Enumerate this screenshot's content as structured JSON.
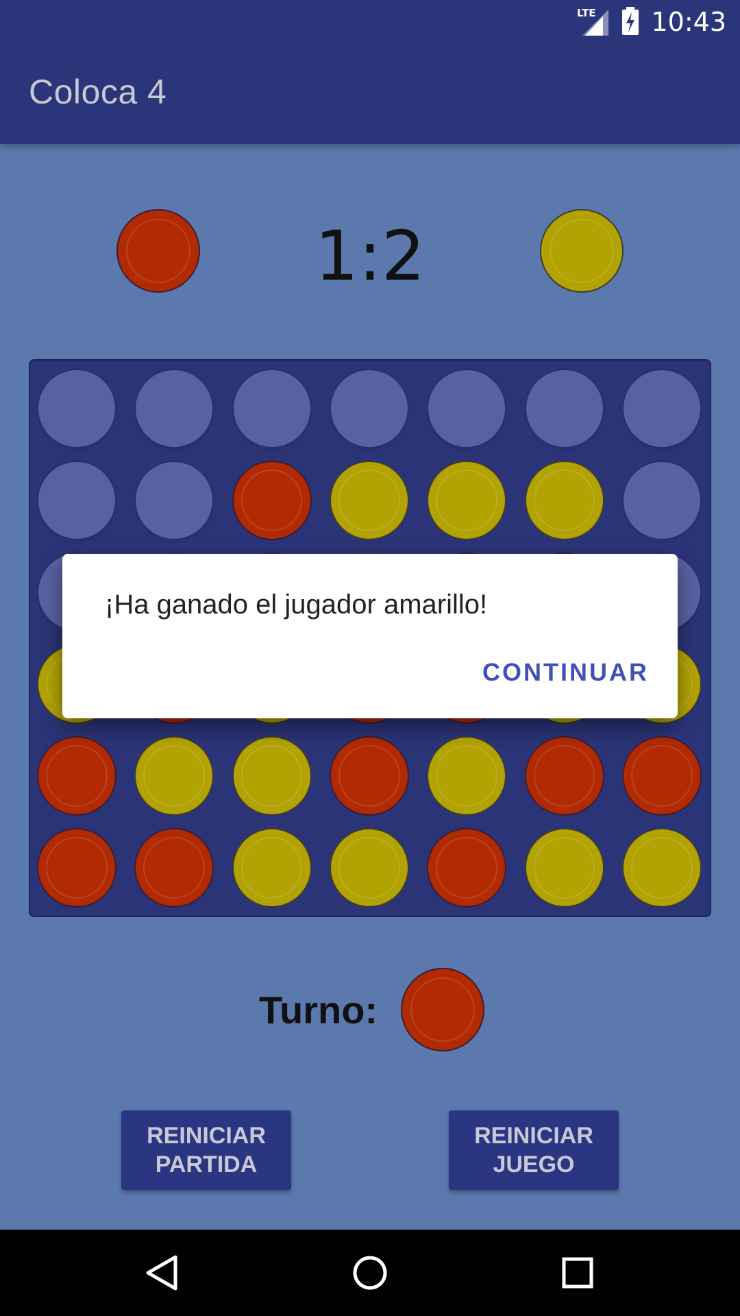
{
  "status_bar": {
    "network": "LTE",
    "time": "10:43",
    "icons": [
      "lte-signal-icon",
      "battery-charging-icon"
    ]
  },
  "app_bar": {
    "title": "Coloca 4"
  },
  "scoreboard": {
    "score": "1:2",
    "left_player_color": "red",
    "right_player_color": "yellow"
  },
  "board": {
    "rows": [
      [
        "empty",
        "empty",
        "empty",
        "empty",
        "empty",
        "empty",
        "empty"
      ],
      [
        "empty",
        "empty",
        "red",
        "yellow",
        "yellow",
        "yellow",
        "empty"
      ],
      [
        "empty",
        "empty",
        "red",
        "yellow",
        "red",
        "red",
        "empty"
      ],
      [
        "yellow",
        "red",
        "yellow",
        "red",
        "red",
        "yellow",
        "yellow"
      ],
      [
        "red",
        "yellow",
        "yellow",
        "red",
        "yellow",
        "red",
        "red"
      ],
      [
        "red",
        "red",
        "yellow",
        "yellow",
        "red",
        "yellow",
        "yellow"
      ]
    ]
  },
  "turn": {
    "label": "Turno:",
    "color": "red"
  },
  "buttons": {
    "restart_match": {
      "line1": "REINICIAR",
      "line2": "PARTIDA"
    },
    "restart_game": {
      "line1": "REINICIAR",
      "line2": "JUEGO"
    }
  },
  "dialog": {
    "message": "¡Ha ganado el jugador amarillo!",
    "action": "CONTINUAR"
  },
  "nav_bar": {
    "icons": [
      "back-icon",
      "home-icon",
      "recents-icon"
    ]
  },
  "colors": {
    "primary_dark": "#2b367a",
    "background": "#5b79ad",
    "red_chip": "#b22a02",
    "yellow_chip": "#b3a302",
    "empty_slot": "#5862a3",
    "accent": "#3f51b5"
  }
}
